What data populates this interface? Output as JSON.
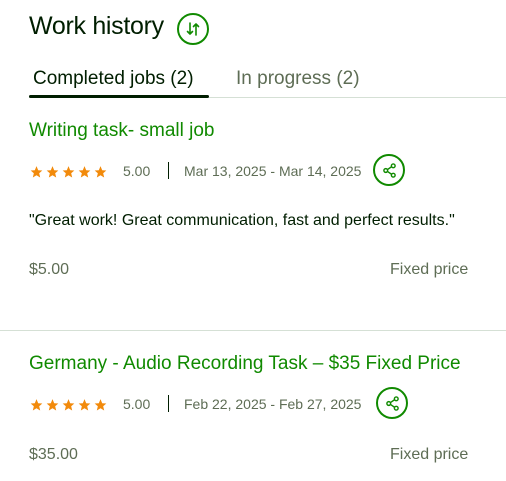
{
  "header": {
    "title": "Work history",
    "sort_icon": "sort-arrows-icon"
  },
  "tabs": [
    {
      "label": "Completed jobs (2)",
      "active": true
    },
    {
      "label": "In progress (2)",
      "active": false
    }
  ],
  "colors": {
    "accent": "#108a00",
    "text": "#001e00",
    "muted": "#5e6d55",
    "star": "#f28a0b"
  },
  "jobs": [
    {
      "title": "Writing task- small job",
      "stars": 5,
      "rating": "5.00",
      "dates": "Mar 13, 2025 - Mar 14, 2025",
      "feedback": "\"Great work! Great communication, fast and perfect results.\"",
      "price": "$5.00",
      "price_type": "Fixed price"
    },
    {
      "title": "Germany - Audio Recording Task – $35 Fixed Price",
      "stars": 5,
      "rating": "5.00",
      "dates": "Feb 22, 2025 - Feb 27, 2025",
      "feedback": "",
      "price": "$35.00",
      "price_type": "Fixed price"
    }
  ]
}
